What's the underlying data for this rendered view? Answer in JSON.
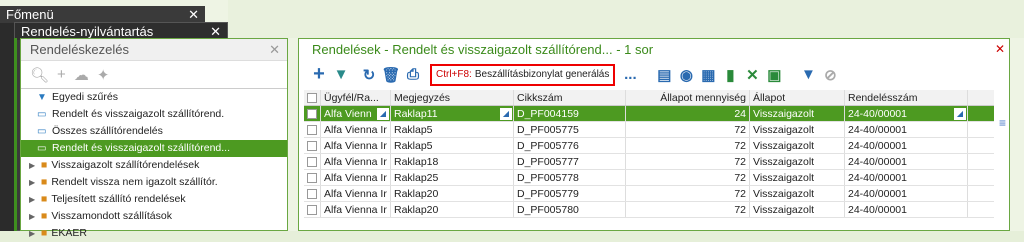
{
  "windows": {
    "fomenu": {
      "title": "Főmenü",
      "close": "✕"
    },
    "rendeles": {
      "title": "Rendelés-nyilvántartás",
      "close": "✕"
    },
    "kezeles": {
      "title": "Rendeléskezelés",
      "close": "✕"
    },
    "main": {
      "title": "Rendelések - Rendelt és visszaigazolt szállítórend... - 1 sor",
      "close": "✕"
    }
  },
  "tree": {
    "items": [
      {
        "label": "Egyedi szűrés",
        "icon": "filter-icon"
      },
      {
        "label": "Rendelt és visszaigazolt szállítórend.",
        "icon": "monitor-icon"
      },
      {
        "label": "Összes szállítórendelés",
        "icon": "monitor-icon"
      },
      {
        "label": "Rendelt és visszaigazolt szállítórend...",
        "icon": "monitor-icon",
        "selected": true
      }
    ],
    "folders": [
      "Visszaigazolt szállítórendelések",
      "Rendelt vissza nem igazolt szállítór.",
      "Teljesített szállító rendelések",
      "Visszamondott szállítások",
      "EKAER"
    ]
  },
  "toolbar": {
    "hint_key": "Ctrl+F8:",
    "hint_text": "Beszállításbizonylat generálás",
    "more": "..."
  },
  "grid": {
    "headers": [
      "Ügyfél/Ra...",
      "Megjegyzés",
      "Cikkszám",
      "Állapot mennyiség",
      "Állapot",
      "Rendelésszám"
    ],
    "rows": [
      [
        "Alfa Vienn",
        "Raklap11",
        "D_PF004159",
        "24",
        "Visszaigazolt",
        "24-40/00001"
      ],
      [
        "Alfa Vienna Ir",
        "Raklap5",
        "D_PF005775",
        "72",
        "Visszaigazolt",
        "24-40/00001"
      ],
      [
        "Alfa Vienna Ir",
        "Raklap5",
        "D_PF005776",
        "72",
        "Visszaigazolt",
        "24-40/00001"
      ],
      [
        "Alfa Vienna Ir",
        "Raklap18",
        "D_PF005777",
        "72",
        "Visszaigazolt",
        "24-40/00001"
      ],
      [
        "Alfa Vienna Ir",
        "Raklap25",
        "D_PF005778",
        "72",
        "Visszaigazolt",
        "24-40/00001"
      ],
      [
        "Alfa Vienna Ir",
        "Raklap20",
        "D_PF005779",
        "72",
        "Visszaigazolt",
        "24-40/00001"
      ],
      [
        "Alfa Vienna Ir",
        "Raklap20",
        "D_PF005780",
        "72",
        "Visszaigazolt",
        "24-40/00001"
      ]
    ]
  },
  "colors": {
    "accent": "#4d9a21",
    "hint_border": "#e00000"
  }
}
